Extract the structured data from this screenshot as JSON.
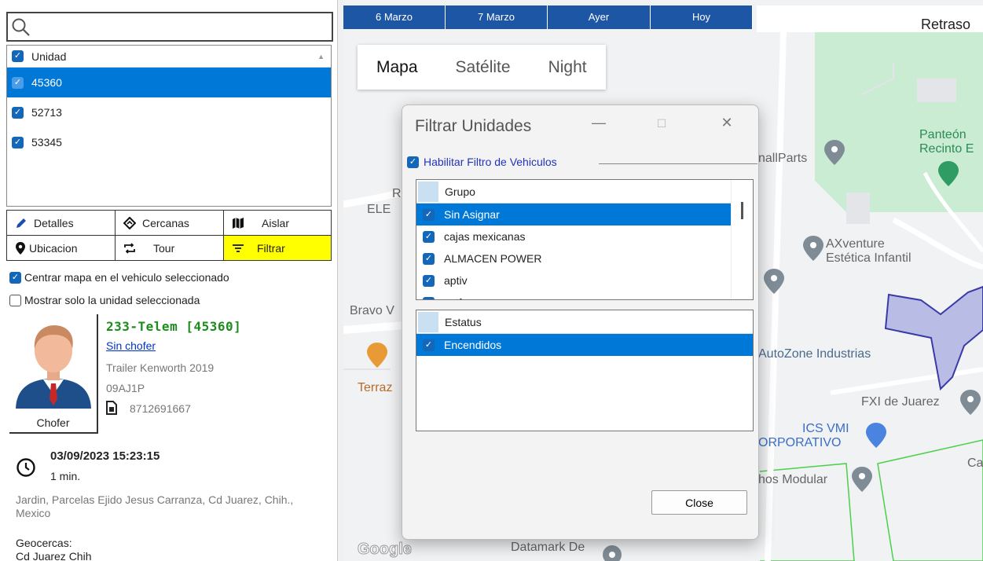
{
  "search": {
    "placeholder": ""
  },
  "unit_list": {
    "header": "Unidad",
    "rows": [
      {
        "label": "45360",
        "selected": true
      },
      {
        "label": "52713",
        "selected": false
      },
      {
        "label": "53345",
        "selected": false
      }
    ]
  },
  "actions": {
    "detalles": "Detalles",
    "cercanas": "Cercanas",
    "aislar": "Aislar",
    "ubicacion": "Ubicacion",
    "tour": "Tour",
    "filtrar": "Filtrar"
  },
  "options": {
    "center_map": "Centrar mapa en el vehiculo seleccionado",
    "center_map_checked": true,
    "only_selected": "Mostrar solo la unidad seleccionada",
    "only_selected_checked": false
  },
  "unit_info": {
    "driver_label": "Chofer",
    "name": "233-Telem [45360]",
    "driver_link": "Sin chofer",
    "vehicle": "Trailer Kenworth 2019",
    "plate": "09AJ1P",
    "phone": "8712691667",
    "datetime": "03/09/2023 15:23:15",
    "duration": "1 min.",
    "address": "Jardin, Parcelas Ejido Jesus Carranza, Cd Juarez, Chih., Mexico",
    "geofence_label": "Geocercas:",
    "geofence_value": "Cd Juarez Chih"
  },
  "date_tabs": [
    "6 Marzo",
    "7 Marzo",
    "Ayer",
    "Hoy"
  ],
  "retraso": "Retraso",
  "map_types": {
    "mapa": "Mapa",
    "satelite": "Satélite",
    "night": "Night"
  },
  "map_labels": {
    "panteon_1": "Panteón",
    "panteon_2": "Recinto E",
    "smallparts": "nallParts",
    "axventure_1": "AXventure",
    "axventure_2": "Estética Infantil",
    "autozone": "AutoZone Industrias",
    "fxi": "FXI de Juarez",
    "ics_1": "ICS VMI",
    "ics_2": "ORPORATIVO",
    "modular": "hos Modular",
    "datamark": "Datamark De",
    "bravo": "Bravo V",
    "terraz": "Terraz",
    "ele": "ELE",
    "r": "R",
    "ca": "Ca",
    "google": "Google"
  },
  "dialog": {
    "title": "Filtrar Unidades",
    "enable_filter": "Habilitar Filtro de Vehiculos",
    "group_header": "Grupo",
    "groups": [
      {
        "label": "Sin Asignar",
        "selected": true
      },
      {
        "label": "cajas mexicanas",
        "selected": false
      },
      {
        "label": "ALMACEN POWER",
        "selected": false
      },
      {
        "label": "aptiv",
        "selected": false
      },
      {
        "label": "catfe",
        "selected": false
      }
    ],
    "status_header": "Estatus",
    "statuses": [
      {
        "label": "Encendidos",
        "selected": true
      }
    ],
    "close": "Close",
    "minimize": "—",
    "maximize": "☐",
    "close_x": "✕"
  },
  "colors": {
    "selection": "#0078d7",
    "date_tabs": "#1e56a6",
    "filter_highlight": "#ffff00",
    "unit_name": "#1c8c1c",
    "geofence_fill": "#b9bde6"
  }
}
